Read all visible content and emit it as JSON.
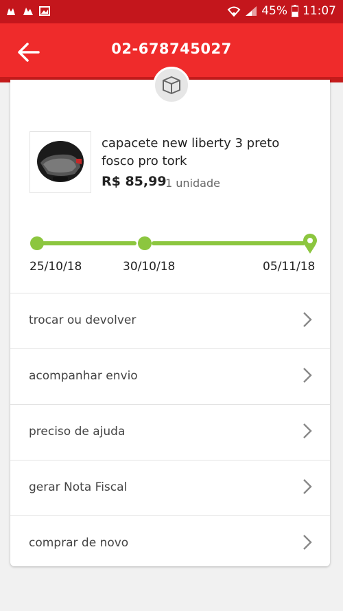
{
  "status_bar": {
    "battery": "45%",
    "time": "11:07"
  },
  "header": {
    "title": "02-678745027",
    "back_icon": "arrow-left-icon"
  },
  "order_badge_icon": "box-icon",
  "product": {
    "name_line1": "capacete new liberty 3 preto",
    "name_line2": "fosco pro tork",
    "price": "R$ 85,99",
    "quantity": "1 unidade"
  },
  "timeline": {
    "dates": [
      "25/10/18",
      "30/10/18",
      "05/11/18"
    ],
    "color": "#8cc63f"
  },
  "menu": {
    "items": [
      {
        "label": "trocar ou devolver"
      },
      {
        "label": "acompanhar envio"
      },
      {
        "label": "preciso de ajuda"
      },
      {
        "label": "gerar Nota Fiscal"
      },
      {
        "label": "comprar de novo"
      }
    ]
  },
  "colors": {
    "brand_red": "#ef2b2b",
    "status_red": "#c4161c",
    "accent_green": "#8cc63f"
  }
}
